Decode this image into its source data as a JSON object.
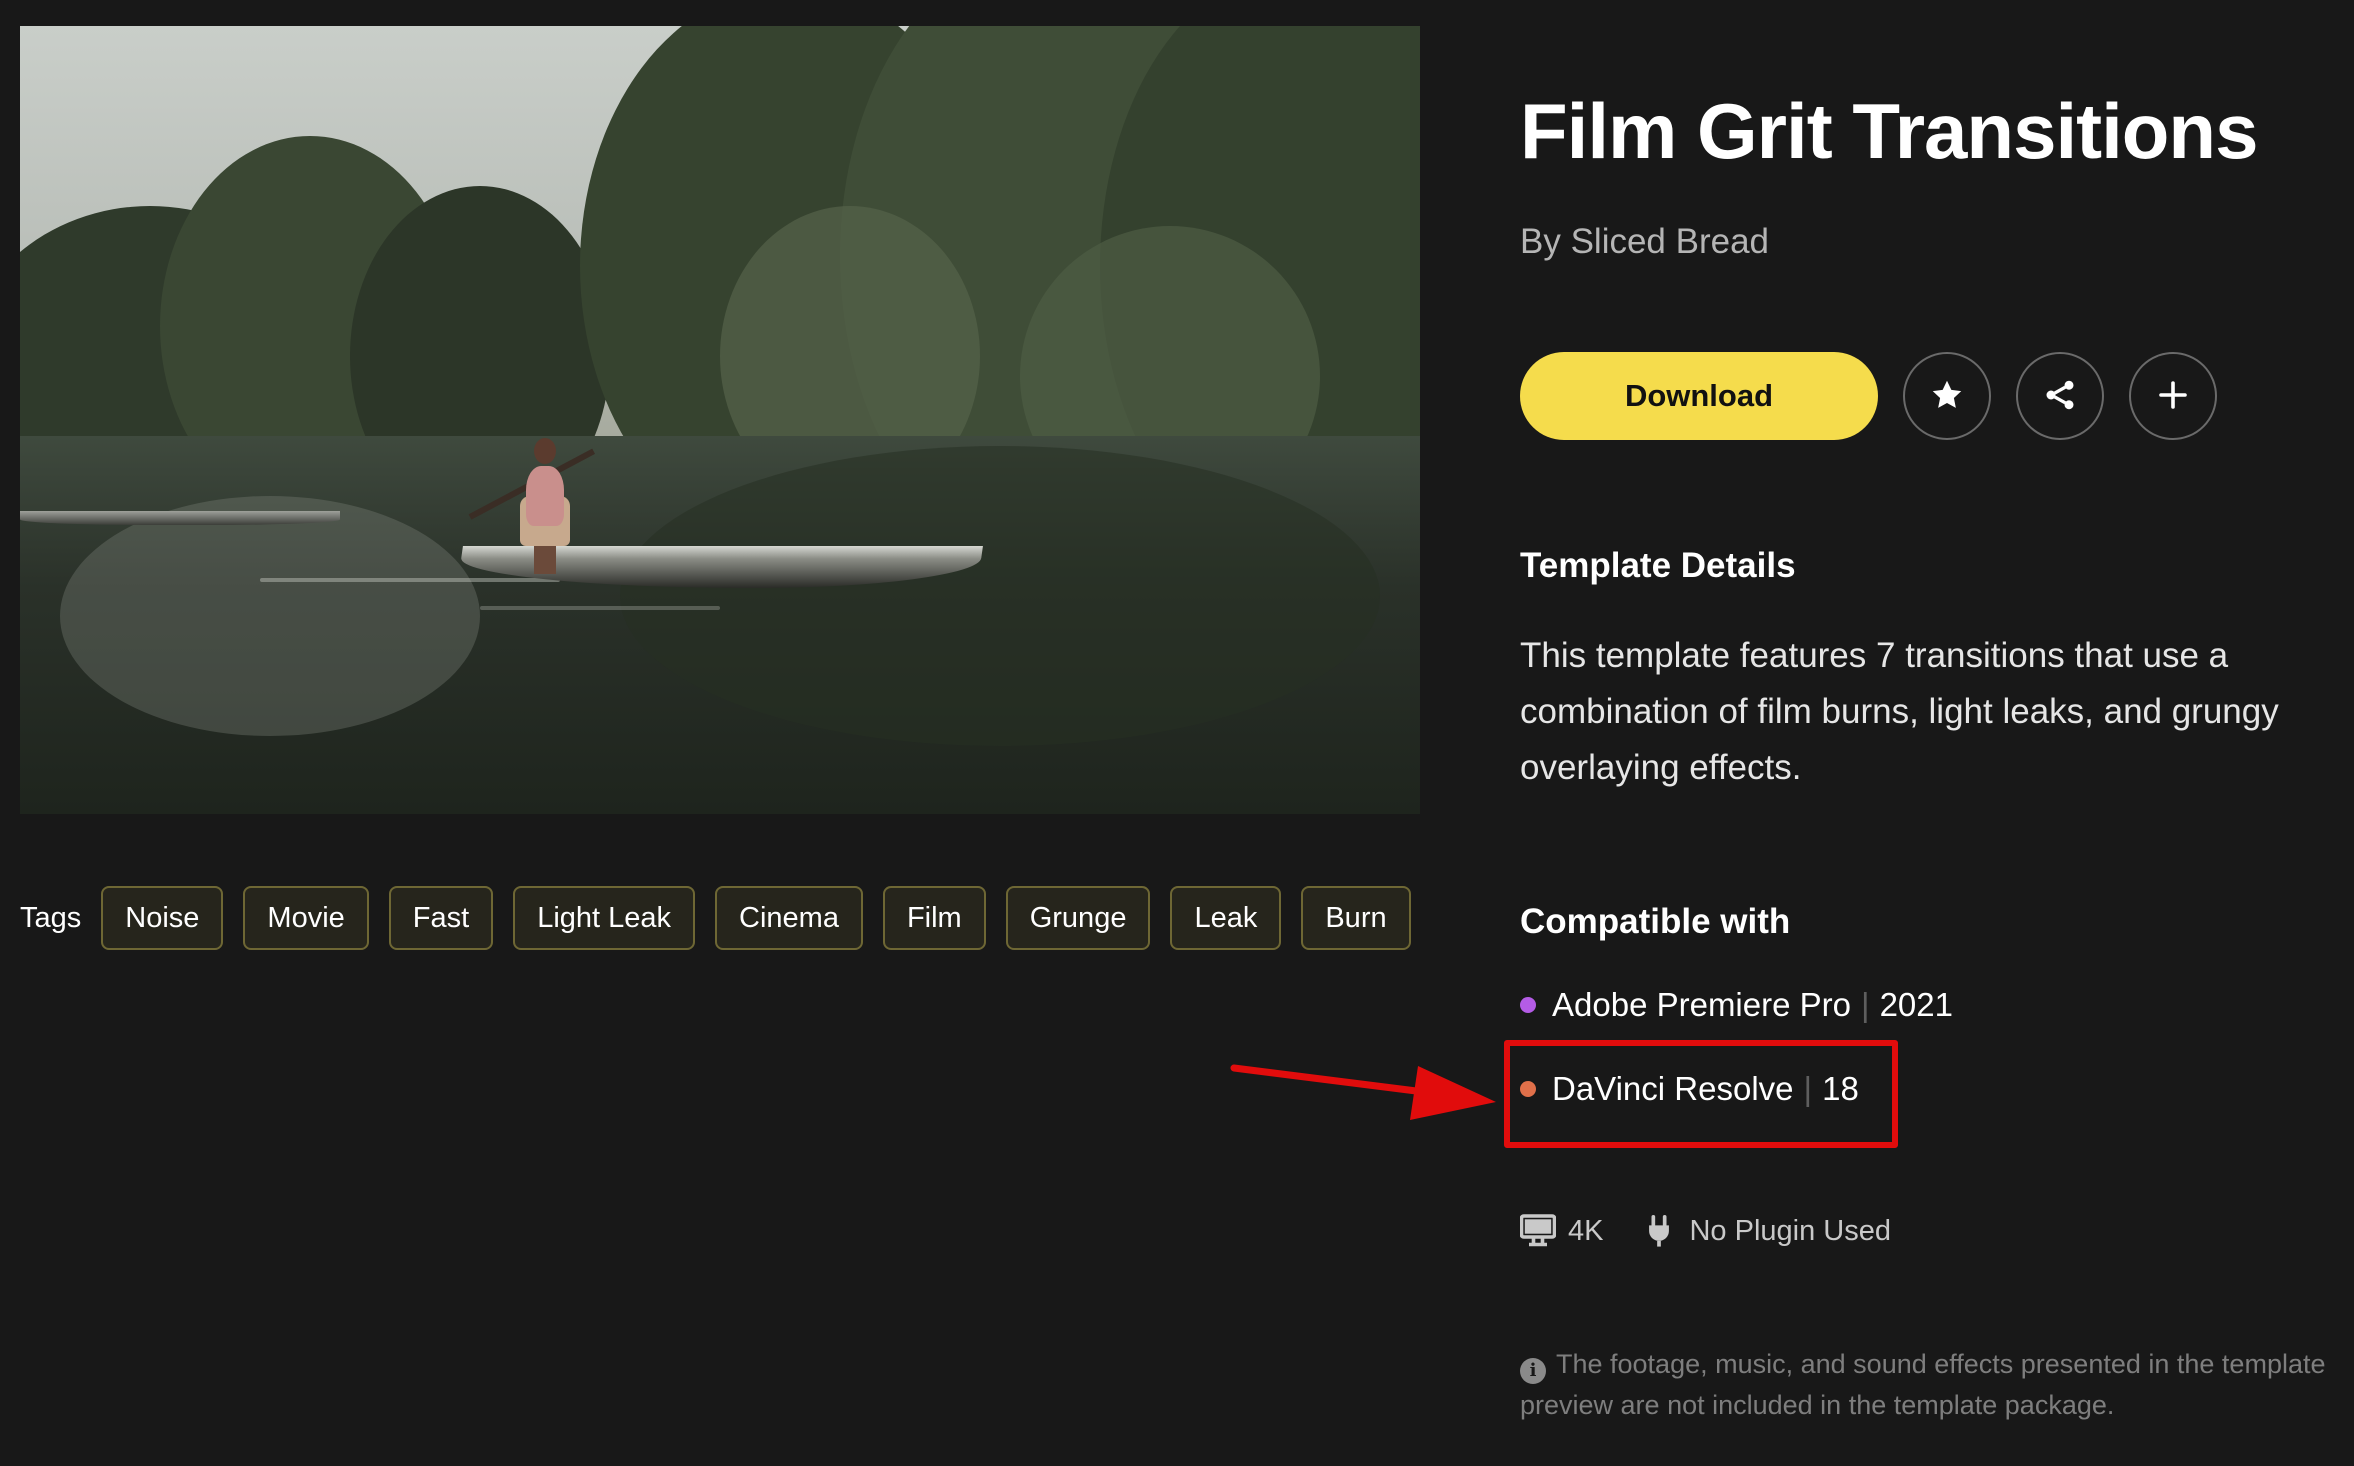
{
  "template": {
    "title": "Film Grit Transitions",
    "author": "By Sliced Bread",
    "download_label": "Download"
  },
  "action_icons": [
    "star-icon",
    "share-icon",
    "plus-icon"
  ],
  "tags": {
    "label": "Tags",
    "items": [
      "Noise",
      "Movie",
      "Fast",
      "Light Leak",
      "Cinema",
      "Film",
      "Grunge",
      "Leak",
      "Burn"
    ]
  },
  "details": {
    "heading": "Template Details",
    "text": "This template features 7 transitions that use a combination of film burns, light leaks, and grungy overlaying effects."
  },
  "compatible": {
    "heading": "Compatible with",
    "items": [
      {
        "app": "Adobe Premiere Pro",
        "version": "2021",
        "color": "#b45ce6"
      },
      {
        "app": "DaVinci Resolve",
        "version": "18",
        "color": "#e0704a"
      }
    ],
    "separator": "|"
  },
  "meta": {
    "resolution": "4K",
    "plugin": "No Plugin Used"
  },
  "disclaimer": "The footage, music, and sound effects presented in the template preview are not included in the template package.",
  "colors": {
    "background": "#181818",
    "accent": "#f5dc4c",
    "annotation": "#e10c0c"
  }
}
